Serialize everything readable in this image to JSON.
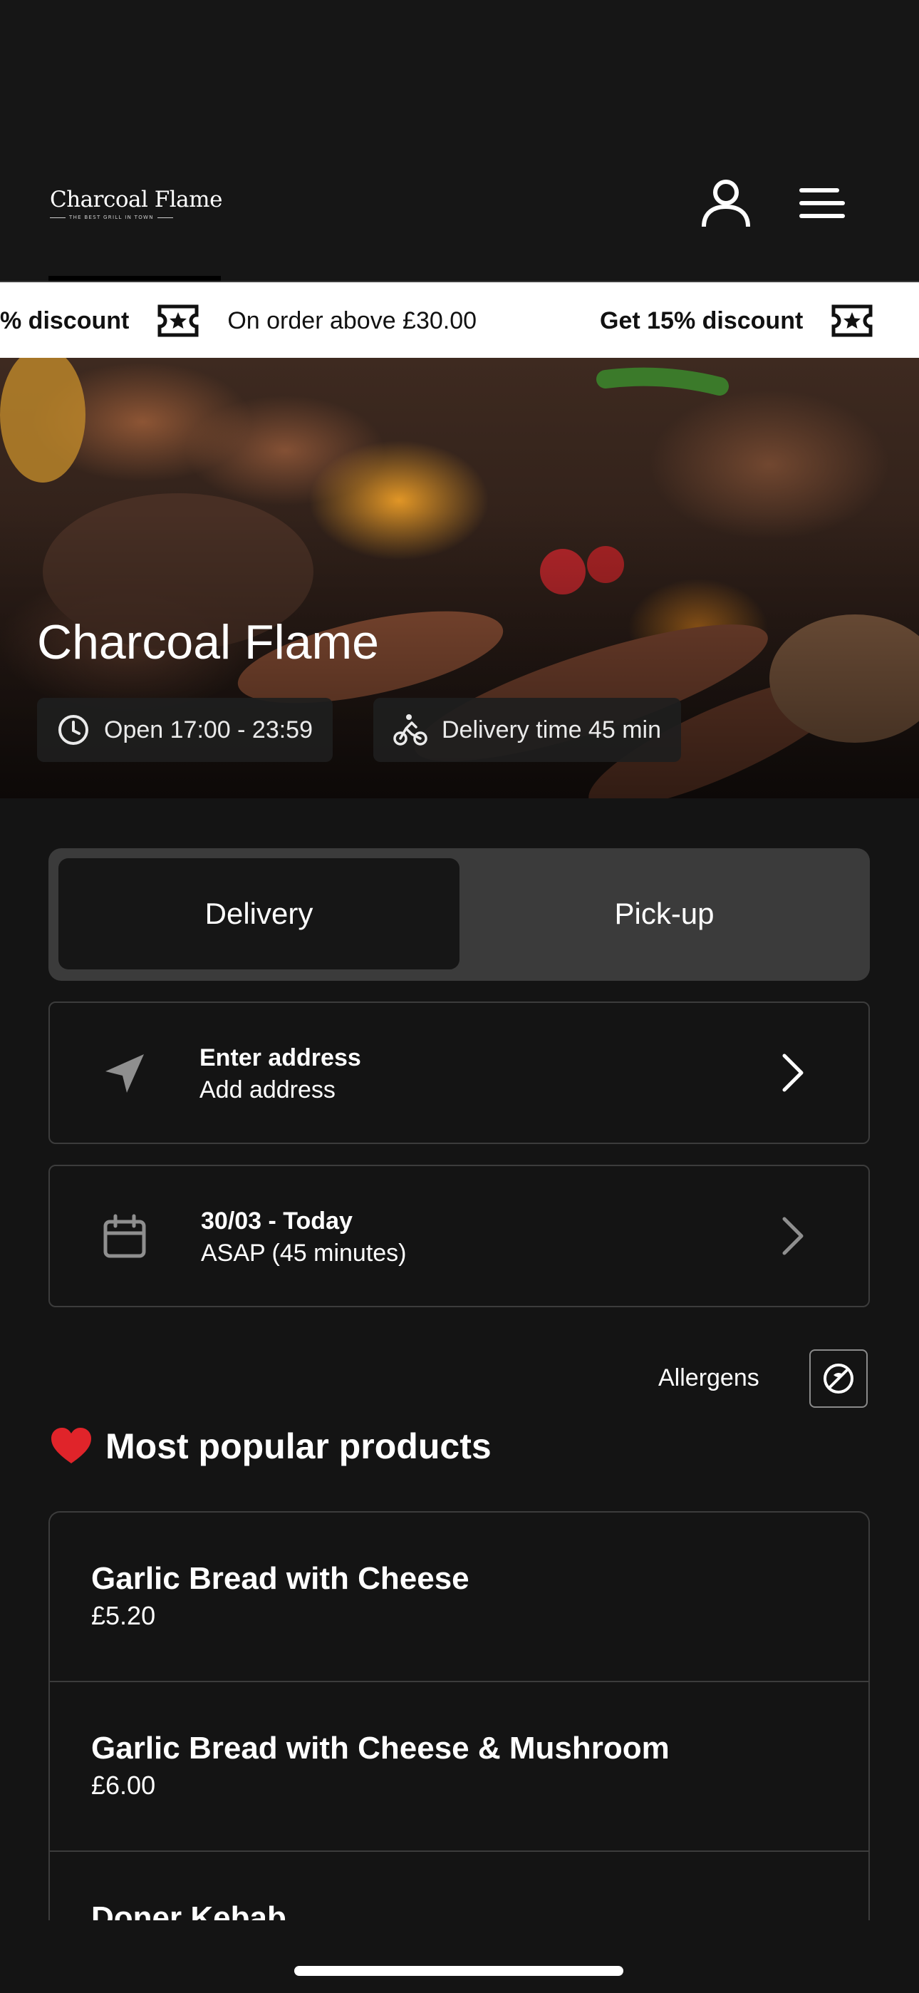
{
  "header": {
    "logo_name": "Charcoal Flame",
    "logo_tagline": "THE BEST GRILL IN TOWN"
  },
  "promo": {
    "items": [
      {
        "bold": "% discount",
        "text": "On order above £30.00"
      },
      {
        "bold": "Get 15% discount",
        "text": ""
      }
    ]
  },
  "hero": {
    "title": "Charcoal Flame",
    "hours": "Open 17:00 - 23:59",
    "delivery_time": "Delivery time 45 min"
  },
  "order_mode": {
    "options": [
      "Delivery",
      "Pick-up"
    ],
    "selected": "Delivery"
  },
  "address_card": {
    "title": "Enter address",
    "subtitle": "Add address"
  },
  "time_card": {
    "title": "30/03 - Today",
    "subtitle": "ASAP (45 minutes)"
  },
  "allergens": {
    "label": "Allergens"
  },
  "popular": {
    "emoji": "❤️",
    "title": "Most popular products",
    "products": [
      {
        "name": "Garlic Bread with Cheese",
        "price": "£5.20"
      },
      {
        "name": "Garlic Bread with Cheese & Mushroom",
        "price": "£6.00"
      },
      {
        "name": "Doner Kebab",
        "price": ""
      }
    ]
  },
  "icons": [
    "user-icon",
    "menu-icon",
    "ticket-star-icon",
    "clock-icon",
    "cyclist-icon",
    "location-arrow-icon",
    "calendar-icon",
    "chevron-right-icon",
    "no-allergen-icon",
    "heart-icon"
  ]
}
